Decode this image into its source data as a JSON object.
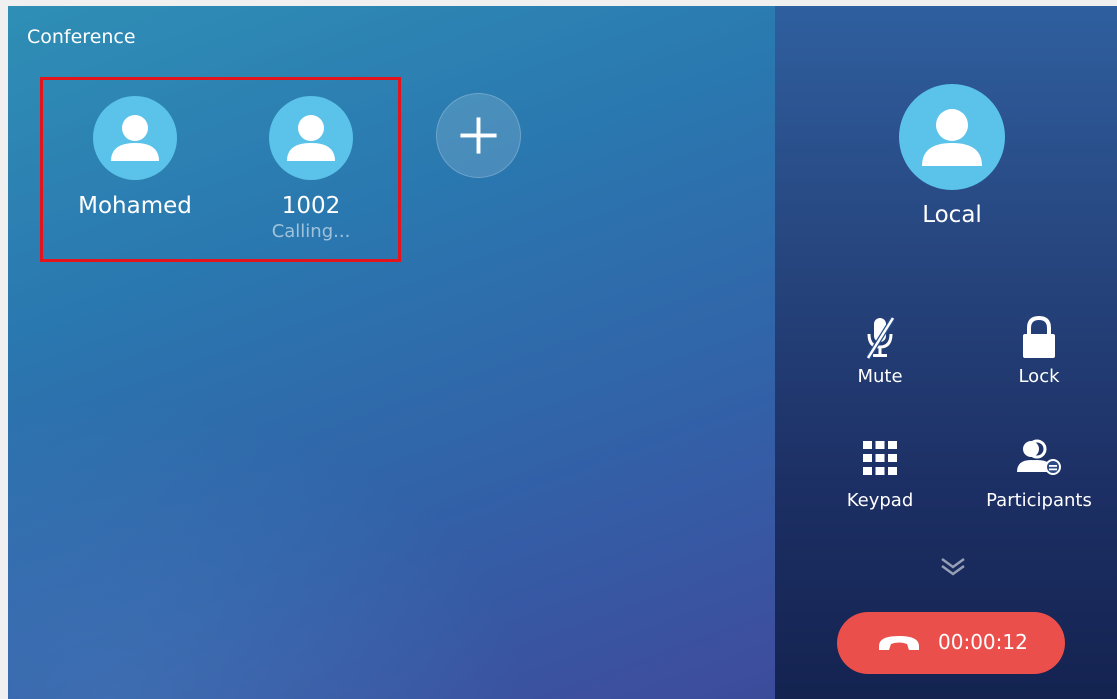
{
  "screen": {
    "title": "Conference"
  },
  "participants": [
    {
      "name": "Mohamed",
      "status": ""
    },
    {
      "name": "1002",
      "status": "Calling..."
    }
  ],
  "local": {
    "name": "Local"
  },
  "controls": {
    "mute": "Mute",
    "lock": "Lock",
    "keypad": "Keypad",
    "participants": "Participants"
  },
  "call": {
    "duration": "00:00:12"
  },
  "colors": {
    "avatar": "#5bc3ea",
    "hangup": "#ea4f4b",
    "highlight_border": "#e3141b"
  },
  "icons": {
    "avatar": "person-icon",
    "add": "plus-icon",
    "mute": "mic-off-icon",
    "lock": "lock-icon",
    "keypad": "keypad-icon",
    "participants": "participants-icon",
    "expand": "chevron-double-down-icon",
    "hangup": "hang-up-icon"
  }
}
